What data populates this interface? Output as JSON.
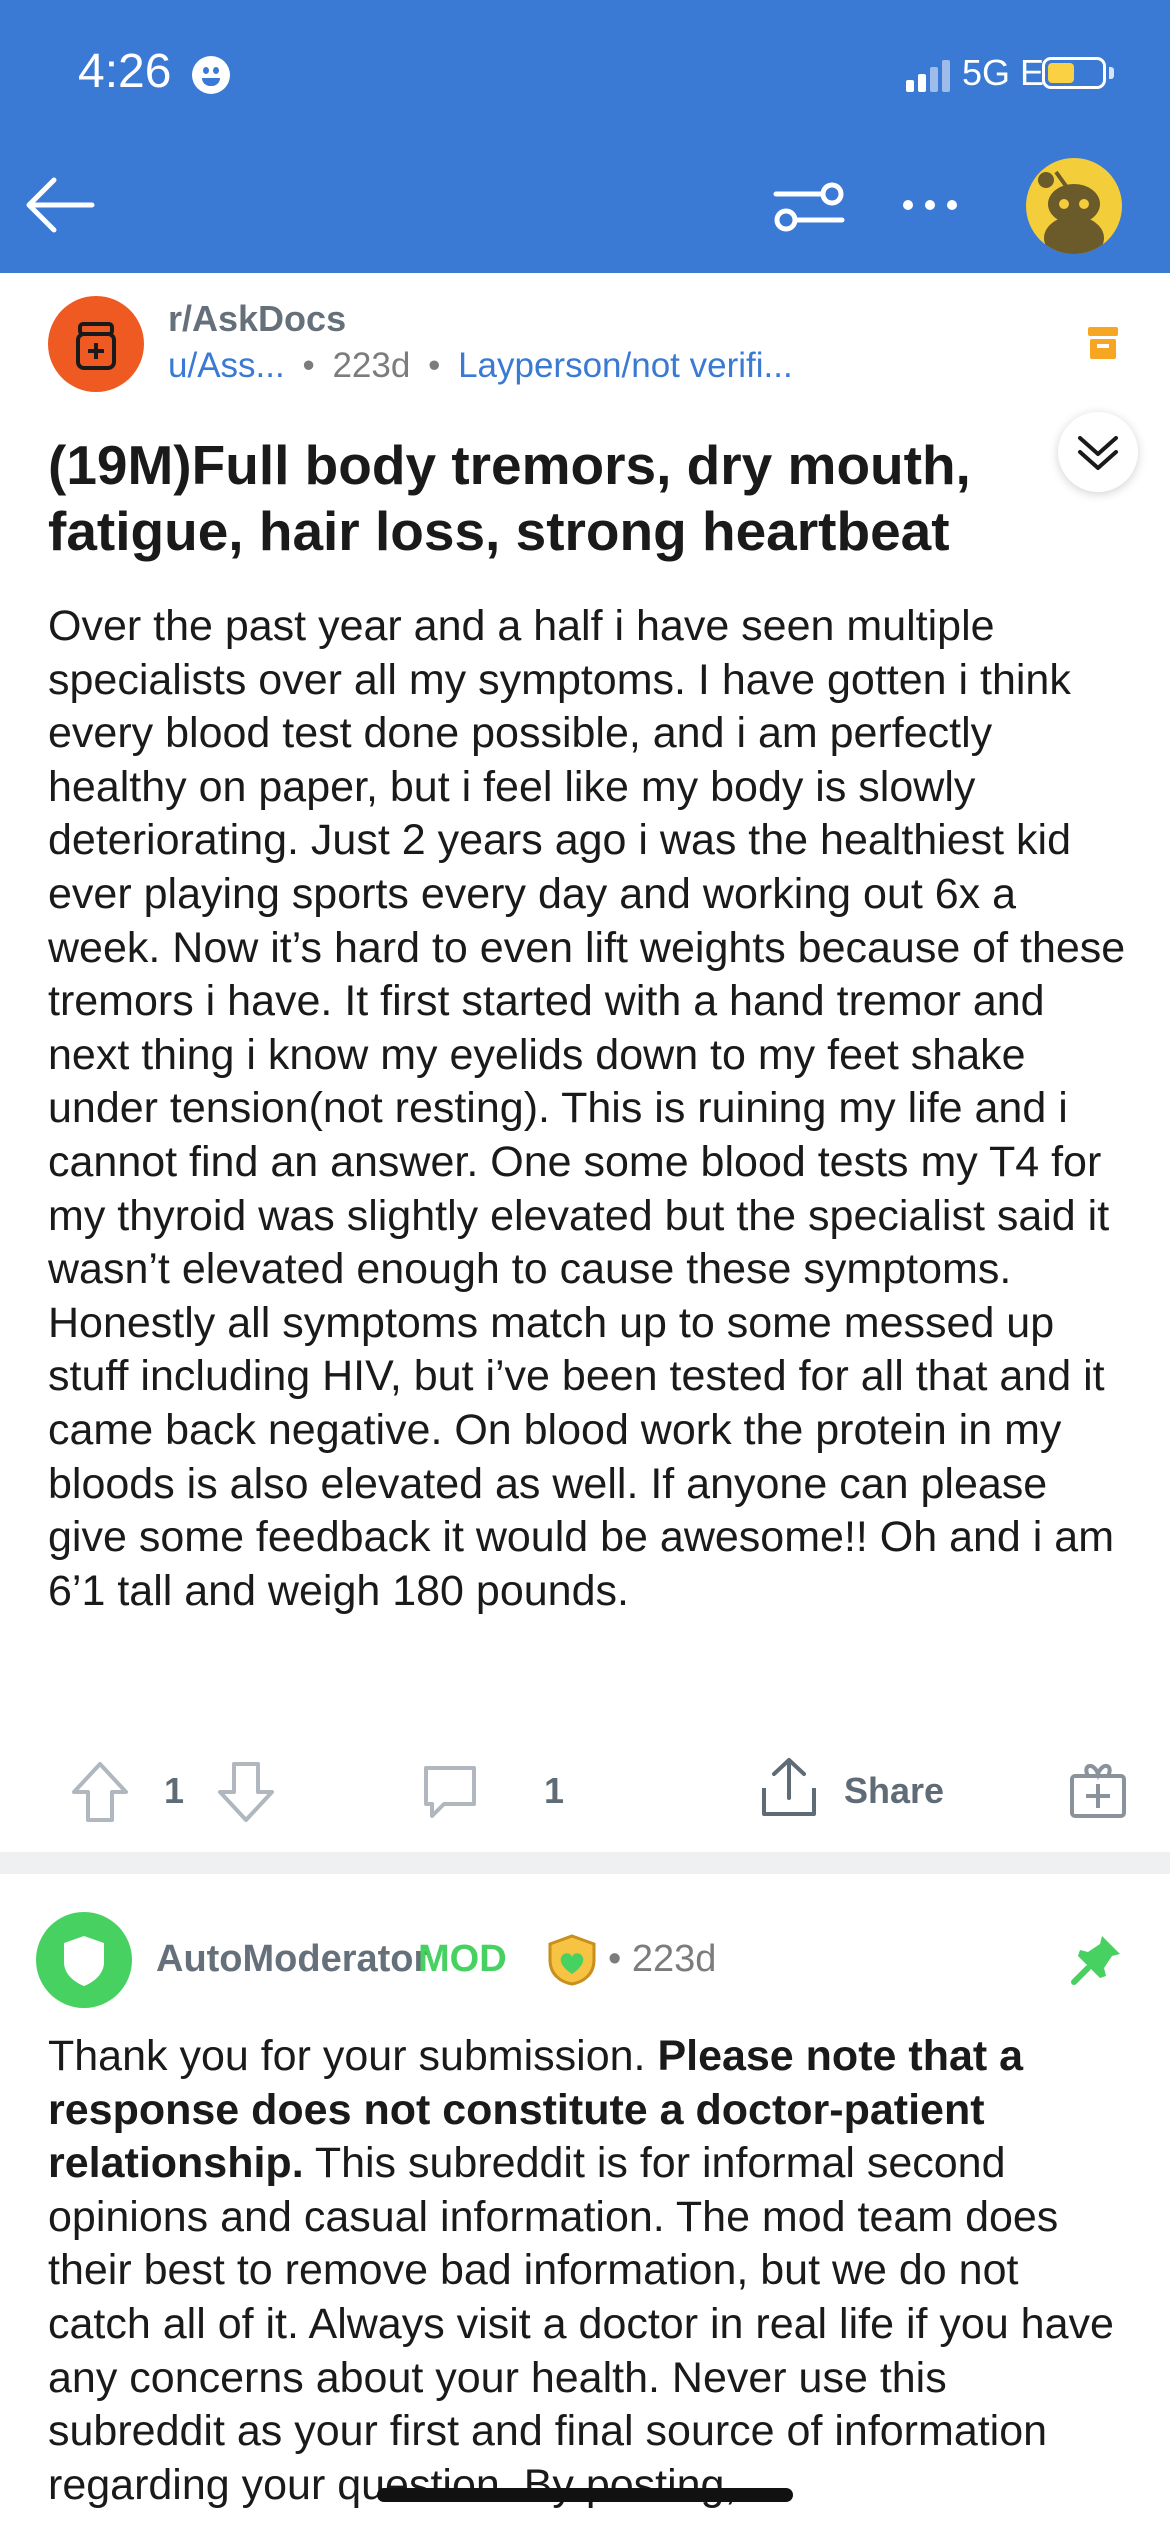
{
  "status_bar": {
    "time": "4:26",
    "network": "5G E"
  },
  "post": {
    "subreddit": "r/AskDocs",
    "author": "u/Ass...",
    "age": "223d",
    "flair": "Layperson/not verifi...",
    "title": "(19M)Full body tremors, dry mouth, fatigue, hair loss, strong heartbeat",
    "body": "Over the past year and a half i have seen multiple specialists over all my symptoms. I have gotten i think every blood test done possible, and i am perfectly healthy on paper, but i feel like my body is slowly deteriorating. Just 2 years ago i was the healthiest kid ever playing sports every day and working out 6x a week. Now it’s hard to even lift weights because of these tremors i have. It first started with a hand tremor and next thing i know my eyelids down to my feet shake under tension(not resting). This is ruining my life and i cannot find an answer. One some blood tests my T4 for my thyroid was slightly elevated but the specialist said it wasn’t elevated enough to cause these symptoms. Honestly all symptoms match up to some messed up stuff including HIV, but i’ve been tested for all that and it came back negative. On blood work the protein in my bloods is also elevated as well. If anyone can please give some feedback it would be awesome!! Oh and i am 6’1 tall and weigh 180 pounds.",
    "vote_count": "1",
    "comment_count": "1",
    "share_label": "Share"
  },
  "comment": {
    "author": "AutoModerator",
    "badge": "MOD",
    "age": "223d",
    "text_intro": "Thank you for your submission. ",
    "text_bold": "Please note that a response does not constitute a doctor-patient relationship.",
    "text_rest": " This subreddit is for informal second opinions and casual information. The mod team does their best to remove bad information, but we do not catch all of it. Always visit a doctor in real life if you have any concerns about your health. Never use this subreddit as your first and final source of information regarding your question. By posting,"
  },
  "colors": {
    "header": "#3a79d4",
    "subreddit_icon": "#ef5a23",
    "mod_green": "#46d160"
  }
}
